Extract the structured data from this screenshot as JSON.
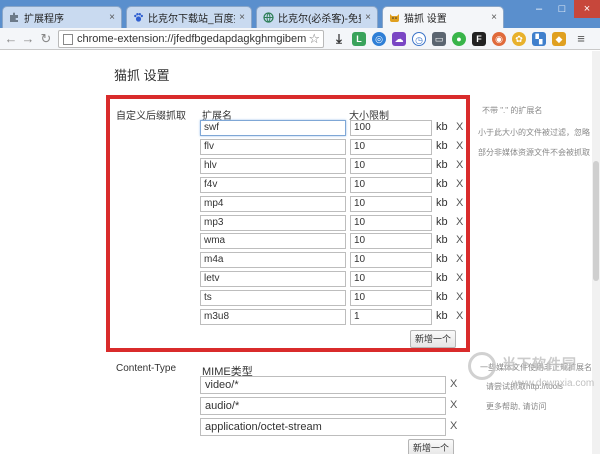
{
  "tabs": [
    {
      "label": "扩展程序",
      "icon": "puzzle-icon",
      "active": false
    },
    {
      "label": "比克尔下载站_百度搜索",
      "icon": "paw-icon",
      "active": false
    },
    {
      "label": "比克尔(必杀客)-免费、绿色",
      "icon": "globe-icon",
      "active": false
    },
    {
      "label": "猫抓 设置",
      "icon": "cat-icon",
      "active": true
    }
  ],
  "omnibox": {
    "url": "chrome-extension://jfedfbgedapdagkghmgibem"
  },
  "page": {
    "title": "猫抓 设置",
    "suffix_section": {
      "label": "自定义后缀抓取",
      "col_name": "扩展名",
      "col_size": "大小限制",
      "unit": "kb",
      "delete_label": "X",
      "rows": [
        {
          "ext": "swf",
          "size": "100"
        },
        {
          "ext": "flv",
          "size": "10"
        },
        {
          "ext": "hlv",
          "size": "10"
        },
        {
          "ext": "f4v",
          "size": "10"
        },
        {
          "ext": "mp4",
          "size": "10"
        },
        {
          "ext": "mp3",
          "size": "10"
        },
        {
          "ext": "wma",
          "size": "10"
        },
        {
          "ext": "m4a",
          "size": "10"
        },
        {
          "ext": "letv",
          "size": "10"
        },
        {
          "ext": "ts",
          "size": "10"
        },
        {
          "ext": "m3u8",
          "size": "1"
        }
      ],
      "add_button": "新增一个"
    },
    "hints": [
      "不带 \".\" 的扩展名",
      "小于此大小的文件被过滤，忽略",
      "部分非媒体资源文件不会被抓取"
    ],
    "mime_section": {
      "label": "Content-Type",
      "col_name": "MIME类型",
      "delete_label": "X",
      "rows": [
        "video/*",
        "audio/*",
        "application/octet-stream"
      ],
      "add_button": "新增一个"
    },
    "mime_hints": [
      "一些媒体文件使用非正规扩展名",
      "请尝试抓取http://tools",
      "更多帮助, 请访问"
    ]
  },
  "watermark": {
    "text": "当下软件园",
    "url": "www.downxia.com"
  },
  "colors": {
    "highlight_box": "#d92b2b",
    "tabbar": "#5a8fcd"
  }
}
